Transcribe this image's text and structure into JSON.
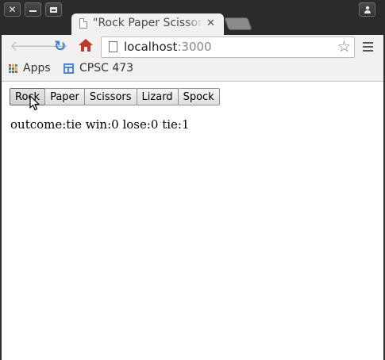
{
  "window": {
    "tab_title": "\"Rock Paper Scissors",
    "tab_close": "✕"
  },
  "toolbar": {
    "url_host": "localhost",
    "url_port": ":3000"
  },
  "bookmarks": [
    {
      "label": "Apps"
    },
    {
      "label": "CPSC 473"
    }
  ],
  "game": {
    "buttons": [
      "Rock",
      "Paper",
      "Scissors",
      "Lizard",
      "Spock"
    ],
    "outcome_text": "outcome:tie win:0 lose:0 tie:1"
  },
  "icons": {
    "apps_grid_colors": [
      "#e04a3f",
      "#f4b400",
      "#3f8be0",
      "#0f9d58",
      "#e04a3f",
      "#f4b400",
      "#3f8be0",
      "#0f9d58",
      "#e04a3f"
    ]
  },
  "colors": {
    "reload_accent": "#3a82d4",
    "home_red": "#c0392b",
    "bookmark_blue": "#4a86d8"
  }
}
